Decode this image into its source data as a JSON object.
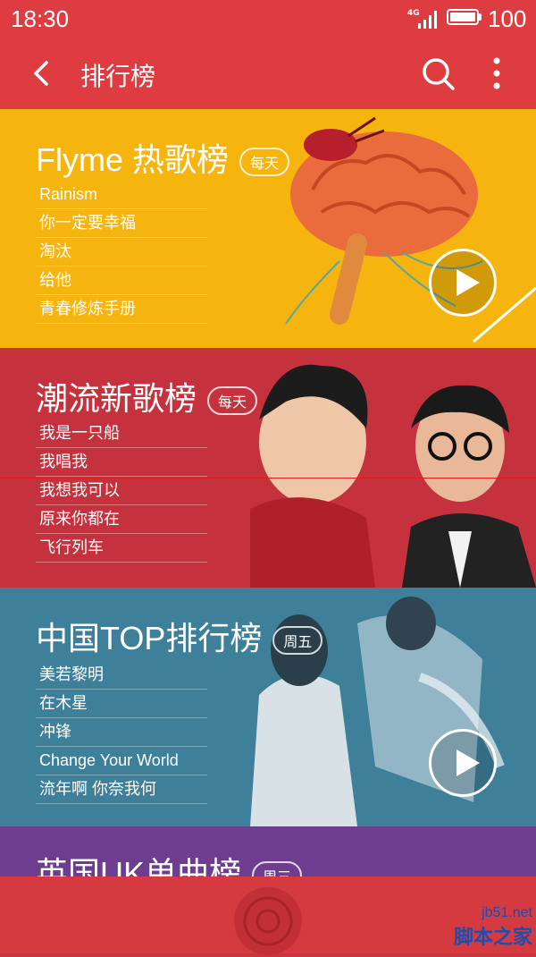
{
  "status": {
    "time": "18:30",
    "network": "4G",
    "battery_level": "100"
  },
  "appbar": {
    "title": "排行榜"
  },
  "charts": [
    {
      "title": "Flyme 热歌榜",
      "badge": "每天",
      "songs": [
        "Rainism",
        "你一定要幸福",
        "淘汰",
        "给他",
        "青春修炼手册"
      ]
    },
    {
      "title": "潮流新歌榜",
      "badge": "每天",
      "songs": [
        "我是一只船",
        "我唱我",
        "我想我可以",
        "原来你都在",
        "飞行列车"
      ]
    },
    {
      "title": "中国TOP排行榜",
      "badge": "周五",
      "songs": [
        "美若黎明",
        "在木星",
        "冲锋",
        "Change Your World",
        "流年啊 你奈我何"
      ]
    },
    {
      "title": "英国UK单曲榜",
      "badge": "周三"
    }
  ],
  "watermark": {
    "url": "jb51.net",
    "name": "脚本之家"
  },
  "colors": {
    "header": "#de3c41",
    "card1": "#f6b50e",
    "card2": "#c5323d",
    "card3": "#3e7f9a",
    "card4": "#6d3e8f"
  }
}
